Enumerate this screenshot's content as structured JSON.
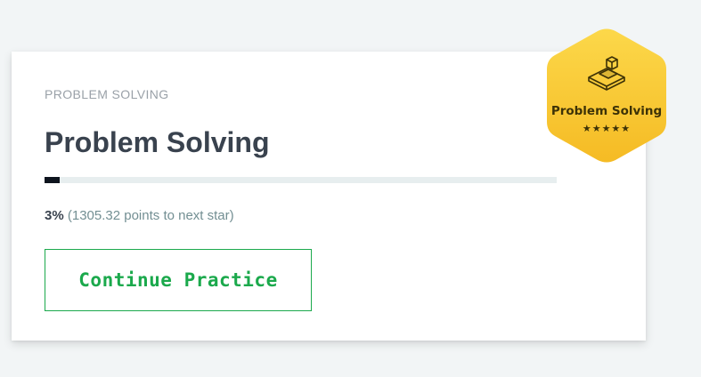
{
  "card": {
    "eyebrow": "PROBLEM SOLVING",
    "title": "Problem Solving",
    "progress": {
      "percent": 3,
      "percent_label": "3%",
      "detail": "(1305.32 points to next star)"
    },
    "continue_label": "Continue Practice"
  },
  "badge": {
    "label": "Problem Solving",
    "stars": "★★★★★",
    "star_count": 5,
    "icon": "cube-stairs-icon"
  },
  "colors": {
    "page_background": "#f2f5f6",
    "accent_green": "#1ba94c",
    "progress_fill": "#0e141e",
    "progress_track": "#e7eeef",
    "badge_gold": "#f7c52d",
    "title_text": "#39424e"
  }
}
